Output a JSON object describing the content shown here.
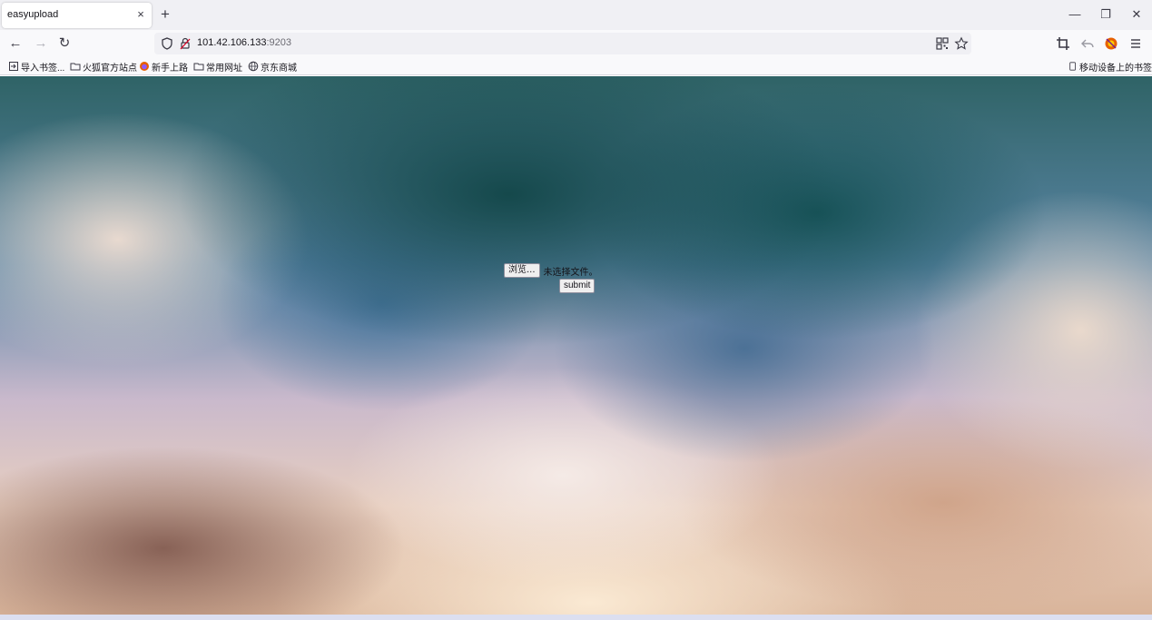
{
  "tab": {
    "title": "easyupload",
    "close_glyph": "×",
    "new_tab_glyph": "+"
  },
  "window_controls": {
    "minimize": "—",
    "restore": "❐",
    "close": "✕"
  },
  "nav": {
    "back": "←",
    "forward": "→",
    "reload": "↻"
  },
  "urlbar": {
    "host": "101.42.106.133",
    "port": ":9203"
  },
  "bookmarks": {
    "items": [
      {
        "label": "导入书签...",
        "icon": "import-icon"
      },
      {
        "label": "火狐官方站点",
        "icon": "folder-icon"
      },
      {
        "label": "新手上路",
        "icon": "firefox-icon"
      },
      {
        "label": "常用网址",
        "icon": "folder-icon"
      },
      {
        "label": "京东商城",
        "icon": "globe-icon"
      }
    ],
    "mobile": "移动设备上的书签"
  },
  "page": {
    "browse_label": "浏览...",
    "file_status": "未选择文件。",
    "submit_label": "submit"
  },
  "colors": {
    "accent": "#e66000",
    "chrome": "#f0f0f4"
  }
}
